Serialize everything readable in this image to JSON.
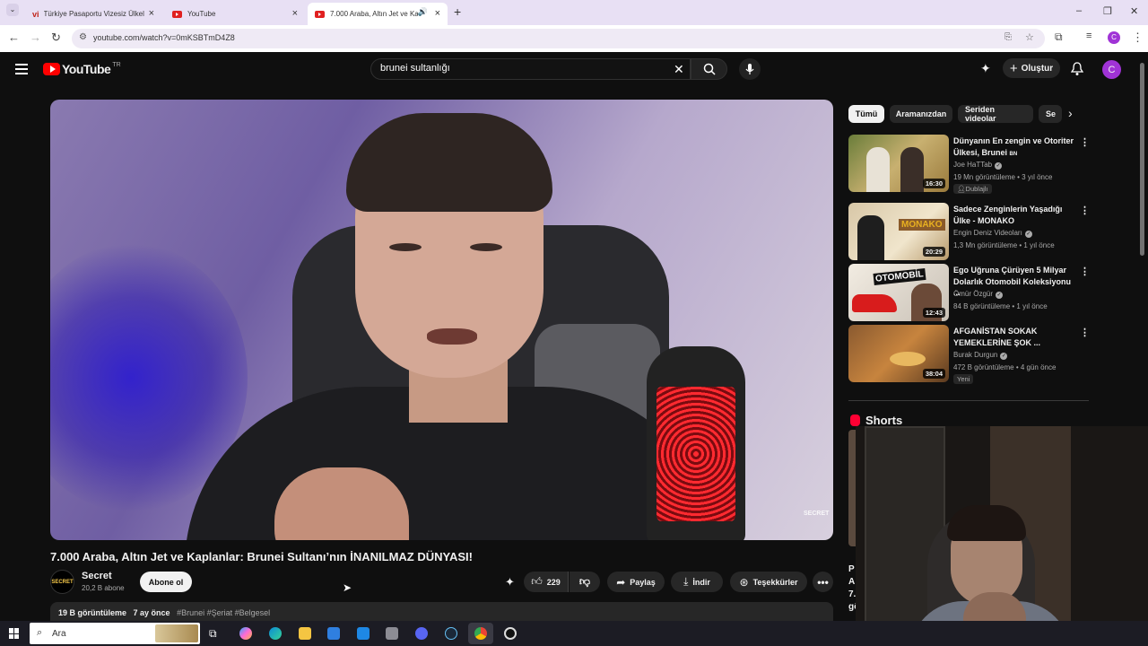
{
  "browser": {
    "tabs": [
      {
        "title": "Türkiye Pasaportu Vizesiz Ülkeler",
        "favicon": "vi"
      },
      {
        "title": "YouTube"
      },
      {
        "title": "7.000 Araba, Altın Jet ve Kaplanlar"
      }
    ],
    "url": "youtube.com/watch?v=0mKSBTmD4Z8"
  },
  "youtube": {
    "logo_text": "YouTube",
    "country": "TR",
    "search_value": "brunei sultanlığı",
    "create_label": "Oluştur",
    "avatar_letter": "C"
  },
  "video": {
    "watermark": "SECRET",
    "title": "7.000 Araba, Altın Jet ve Kaplanlar: Brunei Sultanı’nın İNANILMAZ DÜNYASI!",
    "channel": {
      "name": "Secret",
      "subscribers": "20,2 B abone",
      "avatar_text": "SECRET"
    },
    "subscribe_label": "Abone ol",
    "likes": "229",
    "share_label": "Paylaş",
    "download_label": "İndir",
    "thanks_label": "Teşekkürler",
    "description": {
      "views": "19 B görüntüleme",
      "age": "7 ay önce",
      "tags": "#Brunei #Şeriat #Belgesel"
    }
  },
  "sidebar": {
    "chips": [
      "Tümü",
      "Aramanızdan",
      "Seriden videolar",
      "Se"
    ],
    "recommendations": [
      {
        "title": "Dünyanın En zengin ve Otoriter Ülkesi, Brunei",
        "title_suffix": "BN",
        "channel": "Joe HaTTab",
        "meta": "19 Mn görüntüleme • 3 yıl önce",
        "badge": "Dublajlı",
        "duration": "16:30"
      },
      {
        "title": "Sadece Zenginlerin Yaşadığı Ülke - MONAKO",
        "thumb_text": "MONAKO",
        "channel": "Engin Deniz Videoları",
        "meta": "1,3 Mn görüntüleme • 1 yıl önce",
        "duration": "20:29"
      },
      {
        "title": "Ego Uğruna Çürüyen 5 Milyar Dolarlık Otomobil Koleksiyonu ...",
        "thumb_text": "OTOMOBİL",
        "channel": "Ömür Özgür",
        "meta": "84 B görüntüleme • 1 yıl önce",
        "duration": "12:43"
      },
      {
        "title": "AFGANİSTAN SOKAK YEMEKLERİNE ŞOK ...",
        "channel": "Burak Durgun",
        "meta": "472 B görüntüleme • 4 gün önce",
        "badge": "Yeni",
        "duration": "38:04"
      }
    ],
    "shorts_title": "Shorts",
    "shorts_peek": "P\nA\n7.\ngö"
  },
  "taskbar": {
    "search_placeholder": "Ara"
  }
}
